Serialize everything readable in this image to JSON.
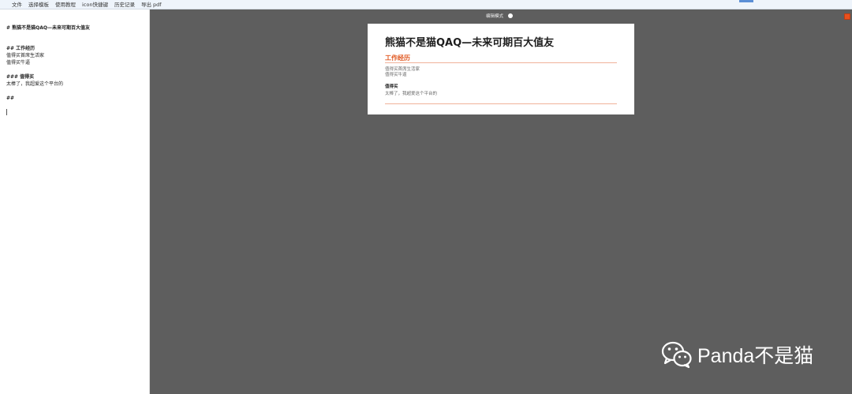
{
  "menu": {
    "items": [
      "文件",
      "选择模板",
      "使用教程",
      "icon快捷键",
      "历史记录",
      "导出 pdf"
    ]
  },
  "editor": {
    "lines": [
      "# 熊猫不是猫QAQ—未来可期百大值友",
      "## 工作经历",
      "值得买首席生活家",
      "值得买牛逼",
      "### 值得买",
      "太棒了，我超爱这个平台的",
      "##"
    ]
  },
  "toolbar": {
    "edit_mode_label": "编辑模式",
    "edit_mode_on": false
  },
  "preview": {
    "title": "熊猫不是猫QAQ—未来可期百大值友",
    "section_title": "工作经历",
    "items": [
      "值得买首席生活家",
      "值得买牛逼"
    ],
    "subsection_title": "值得买",
    "paragraph": "太棒了，我超爱这个平台的"
  },
  "watermark": {
    "logo_icon": "wechat-icon",
    "text": "Panda不是猫"
  },
  "colors": {
    "accent": "#e0561e",
    "canvas": "#5e5e5e",
    "menubar": "#eef4fb"
  }
}
